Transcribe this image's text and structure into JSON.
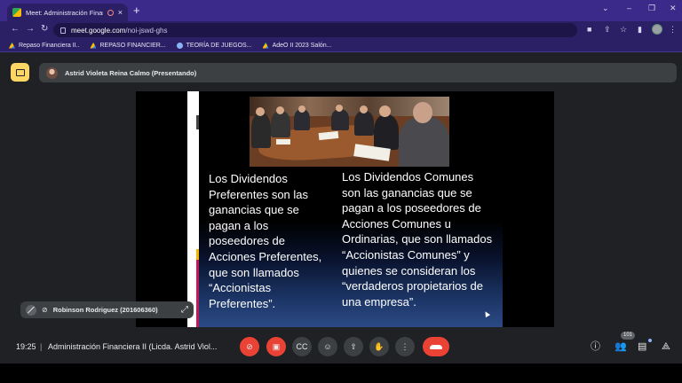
{
  "browser": {
    "tab_title": "Meet: Administración Financ",
    "tab_close": "×",
    "new_tab": "+",
    "url_host": "meet.google.com",
    "url_path": "/noi-jswd-ghs",
    "window_controls": [
      "⌄",
      "–",
      "❐",
      "✕"
    ]
  },
  "bookmarks": [
    {
      "label": "Repaso Financiera II..",
      "icon": "drive-icon"
    },
    {
      "label": "REPASO FINANCIER...",
      "icon": "drive-icon"
    },
    {
      "label": "TEORÍA DE JUEGOS...",
      "icon": "globe-icon"
    },
    {
      "label": "AdeO II 2023 Salón...",
      "icon": "drive-icon"
    }
  ],
  "meet": {
    "presenter_label": "Astrid Violeta Reina Calmo (Presentando)",
    "self_name": "Robinson Rodriguez (201606360)",
    "clock": "19:25",
    "separator": "|",
    "meeting_title": "Administración Financiera II (Licda. Astrid Viol...",
    "participants_count": "101",
    "colors": {
      "end_call": "#ea4335",
      "present_icon": "#fdd663",
      "accent": "#8ab4f8"
    }
  },
  "slide": {
    "left_text": "Los Dividendos\nPreferentes son las\nganancias que se\npagan a los\nposeedores de\nAcciones Preferentes,\nque son llamados\n“Accionistas\nPreferentes”.",
    "right_text": "Los Dividendos Comunes\nson las ganancias que se\npagan a los poseedores de\nAcciones Comunes u\nOrdinarias, que son llamados\n“Accionistas Comunes” y\nquienes se consideran los\n“verdaderos propietarios de\nuna empresa”."
  }
}
